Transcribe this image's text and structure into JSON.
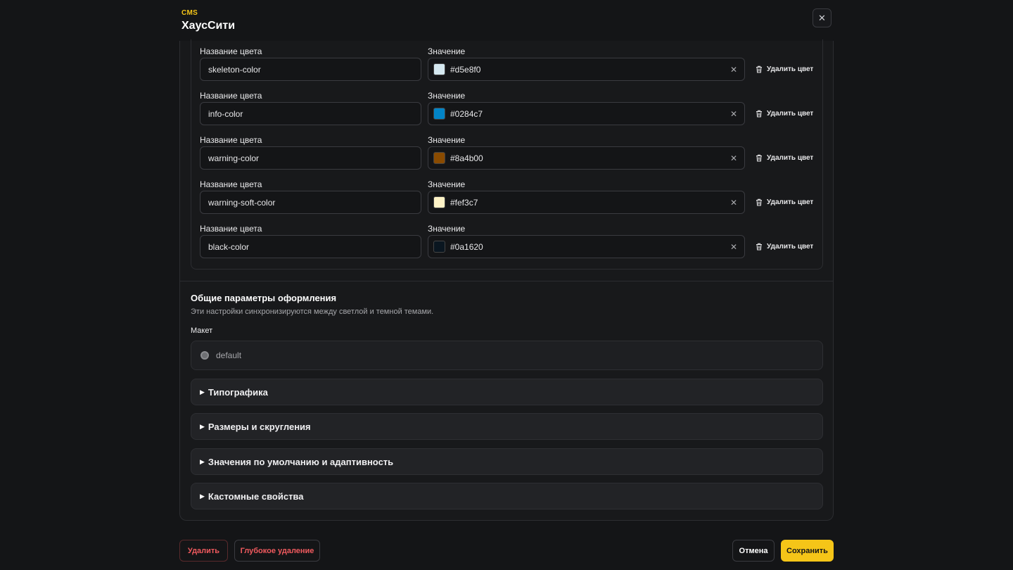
{
  "header": {
    "kicker": "CMS",
    "title": "ХаусСити",
    "close_icon": "close-icon"
  },
  "colors": {
    "name_label": "Название цвета",
    "value_label": "Значение",
    "delete_label": "Удалить цвет",
    "rows": [
      {
        "name": "skeleton-color",
        "value": "#d5e8f0",
        "swatch": "#d5e8f0"
      },
      {
        "name": "info-color",
        "value": "#0284c7",
        "swatch": "#0284c7"
      },
      {
        "name": "warning-color",
        "value": "#8a4b00",
        "swatch": "#8a4b00"
      },
      {
        "name": "warning-soft-color",
        "value": "#fef3c7",
        "swatch": "#fef3c7"
      },
      {
        "name": "black-color",
        "value": "#0a1620",
        "swatch": "#0a1620"
      }
    ]
  },
  "general": {
    "title": "Общие параметры оформления",
    "description": "Эти настройки синхронизируются между светлой и темной темами.",
    "layout_label": "Макет",
    "layout_option": "default",
    "sections": [
      {
        "label": "Типографика"
      },
      {
        "label": "Размеры и скругления"
      },
      {
        "label": "Значения по умолчанию и адаптивность"
      },
      {
        "label": "Кастомные свойства"
      }
    ]
  },
  "footer": {
    "delete_label": "Удалить",
    "deep_delete_label": "Глубокое удаление",
    "cancel_label": "Отмена",
    "save_label": "Сохранить"
  },
  "theme": {
    "accent": "#f5c518",
    "danger": "#f05a5e",
    "background": "#141517"
  }
}
